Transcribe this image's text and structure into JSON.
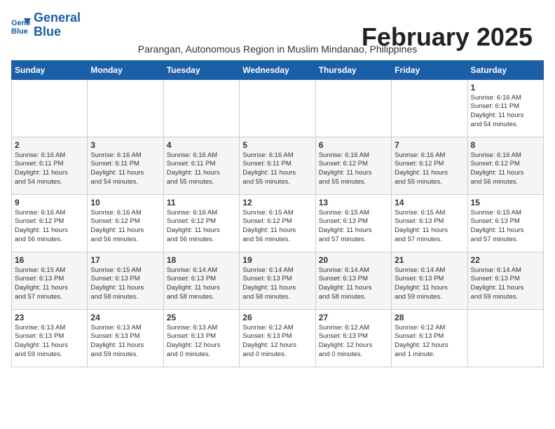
{
  "header": {
    "logo_line1": "General",
    "logo_line2": "Blue",
    "month_title": "February 2025",
    "subtitle": "Parangan, Autonomous Region in Muslim Mindanao, Philippines"
  },
  "weekdays": [
    "Sunday",
    "Monday",
    "Tuesday",
    "Wednesday",
    "Thursday",
    "Friday",
    "Saturday"
  ],
  "weeks": [
    [
      {
        "day": "",
        "text": ""
      },
      {
        "day": "",
        "text": ""
      },
      {
        "day": "",
        "text": ""
      },
      {
        "day": "",
        "text": ""
      },
      {
        "day": "",
        "text": ""
      },
      {
        "day": "",
        "text": ""
      },
      {
        "day": "1",
        "text": "Sunrise: 6:16 AM\nSunset: 6:11 PM\nDaylight: 11 hours\nand 54 minutes."
      }
    ],
    [
      {
        "day": "2",
        "text": "Sunrise: 6:16 AM\nSunset: 6:11 PM\nDaylight: 11 hours\nand 54 minutes."
      },
      {
        "day": "3",
        "text": "Sunrise: 6:16 AM\nSunset: 6:11 PM\nDaylight: 11 hours\nand 54 minutes."
      },
      {
        "day": "4",
        "text": "Sunrise: 6:16 AM\nSunset: 6:11 PM\nDaylight: 11 hours\nand 55 minutes."
      },
      {
        "day": "5",
        "text": "Sunrise: 6:16 AM\nSunset: 6:11 PM\nDaylight: 11 hours\nand 55 minutes."
      },
      {
        "day": "6",
        "text": "Sunrise: 6:16 AM\nSunset: 6:12 PM\nDaylight: 11 hours\nand 55 minutes."
      },
      {
        "day": "7",
        "text": "Sunrise: 6:16 AM\nSunset: 6:12 PM\nDaylight: 11 hours\nand 55 minutes."
      },
      {
        "day": "8",
        "text": "Sunrise: 6:16 AM\nSunset: 6:12 PM\nDaylight: 11 hours\nand 56 minutes."
      }
    ],
    [
      {
        "day": "9",
        "text": "Sunrise: 6:16 AM\nSunset: 6:12 PM\nDaylight: 11 hours\nand 56 minutes."
      },
      {
        "day": "10",
        "text": "Sunrise: 6:16 AM\nSunset: 6:12 PM\nDaylight: 11 hours\nand 56 minutes."
      },
      {
        "day": "11",
        "text": "Sunrise: 6:16 AM\nSunset: 6:12 PM\nDaylight: 11 hours\nand 56 minutes."
      },
      {
        "day": "12",
        "text": "Sunrise: 6:15 AM\nSunset: 6:12 PM\nDaylight: 11 hours\nand 56 minutes."
      },
      {
        "day": "13",
        "text": "Sunrise: 6:15 AM\nSunset: 6:13 PM\nDaylight: 11 hours\nand 57 minutes."
      },
      {
        "day": "14",
        "text": "Sunrise: 6:15 AM\nSunset: 6:13 PM\nDaylight: 11 hours\nand 57 minutes."
      },
      {
        "day": "15",
        "text": "Sunrise: 6:15 AM\nSunset: 6:13 PM\nDaylight: 11 hours\nand 57 minutes."
      }
    ],
    [
      {
        "day": "16",
        "text": "Sunrise: 6:15 AM\nSunset: 6:13 PM\nDaylight: 11 hours\nand 57 minutes."
      },
      {
        "day": "17",
        "text": "Sunrise: 6:15 AM\nSunset: 6:13 PM\nDaylight: 11 hours\nand 58 minutes."
      },
      {
        "day": "18",
        "text": "Sunrise: 6:14 AM\nSunset: 6:13 PM\nDaylight: 11 hours\nand 58 minutes."
      },
      {
        "day": "19",
        "text": "Sunrise: 6:14 AM\nSunset: 6:13 PM\nDaylight: 11 hours\nand 58 minutes."
      },
      {
        "day": "20",
        "text": "Sunrise: 6:14 AM\nSunset: 6:13 PM\nDaylight: 11 hours\nand 58 minutes."
      },
      {
        "day": "21",
        "text": "Sunrise: 6:14 AM\nSunset: 6:13 PM\nDaylight: 11 hours\nand 59 minutes."
      },
      {
        "day": "22",
        "text": "Sunrise: 6:14 AM\nSunset: 6:13 PM\nDaylight: 11 hours\nand 59 minutes."
      }
    ],
    [
      {
        "day": "23",
        "text": "Sunrise: 6:13 AM\nSunset: 6:13 PM\nDaylight: 11 hours\nand 59 minutes."
      },
      {
        "day": "24",
        "text": "Sunrise: 6:13 AM\nSunset: 6:13 PM\nDaylight: 11 hours\nand 59 minutes."
      },
      {
        "day": "25",
        "text": "Sunrise: 6:13 AM\nSunset: 6:13 PM\nDaylight: 12 hours\nand 0 minutes."
      },
      {
        "day": "26",
        "text": "Sunrise: 6:12 AM\nSunset: 6:13 PM\nDaylight: 12 hours\nand 0 minutes."
      },
      {
        "day": "27",
        "text": "Sunrise: 6:12 AM\nSunset: 6:13 PM\nDaylight: 12 hours\nand 0 minutes."
      },
      {
        "day": "28",
        "text": "Sunrise: 6:12 AM\nSunset: 6:13 PM\nDaylight: 12 hours\nand 1 minute."
      },
      {
        "day": "",
        "text": ""
      }
    ]
  ]
}
